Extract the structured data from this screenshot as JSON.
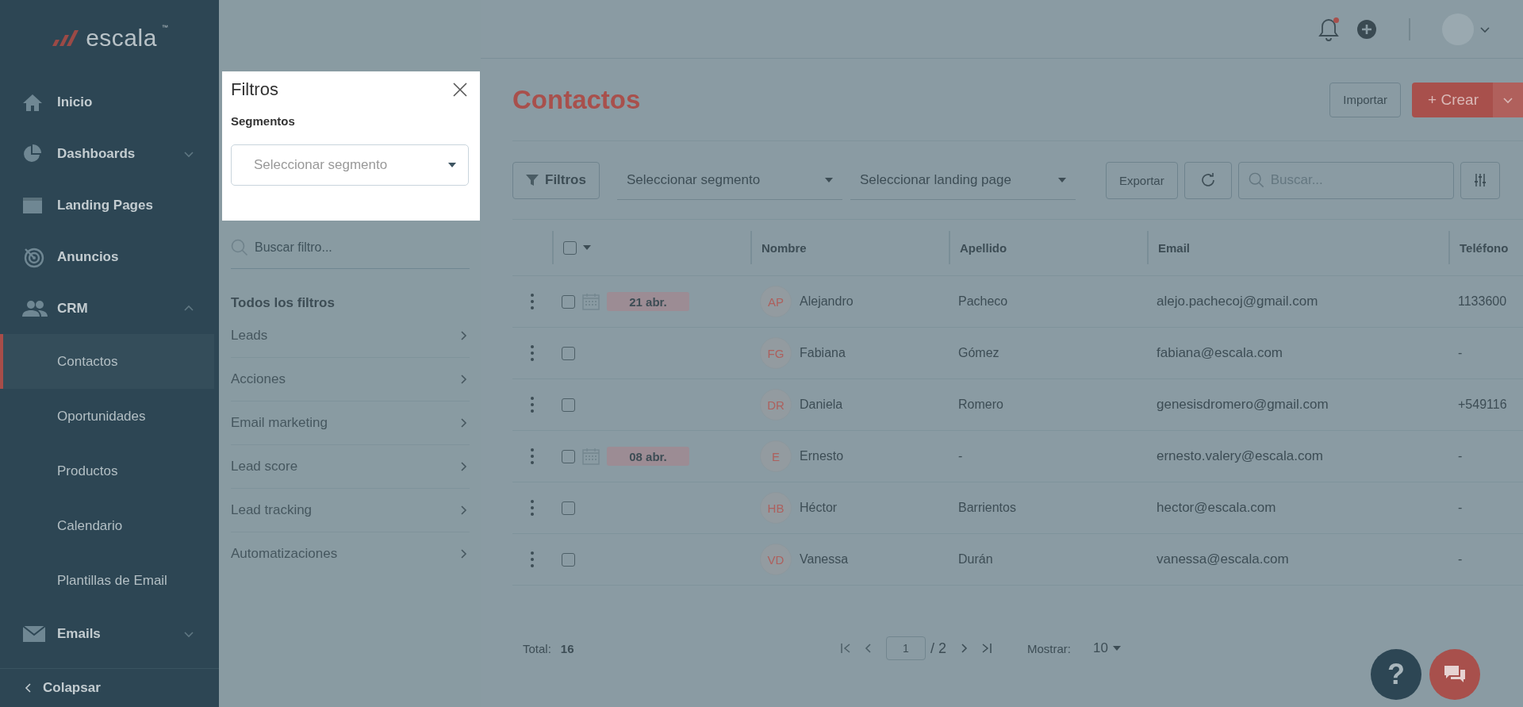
{
  "sidebar": {
    "logo": "escala",
    "logo_trademark": "™",
    "items": [
      {
        "label": "Inicio",
        "selected": false
      },
      {
        "label": "Dashboards",
        "selected": false,
        "expanded": false
      },
      {
        "label": "Landing Pages",
        "selected": false
      },
      {
        "label": "Anuncios",
        "selected": false
      },
      {
        "label": "CRM",
        "selected": false,
        "expanded": true,
        "children": [
          {
            "label": "Contactos",
            "selected": true
          },
          {
            "label": "Oportunidades",
            "selected": false
          },
          {
            "label": "Productos",
            "selected": false
          },
          {
            "label": "Calendario",
            "selected": false
          },
          {
            "label": "Plantillas de Email",
            "selected": false
          }
        ]
      },
      {
        "label": "Emails",
        "selected": false,
        "expanded": false
      }
    ],
    "collapse": "Colapsar"
  },
  "topbar": {
    "notifications_unread": true
  },
  "filter_panel": {
    "title": "Filtros",
    "segment_label": "Segmentos",
    "segment_placeholder": "Seleccionar segmento",
    "search_placeholder": "Buscar filtro...",
    "section_title": "Todos los filtros",
    "categories": [
      "Leads",
      "Acciones",
      "Email marketing",
      "Lead score",
      "Lead tracking",
      "Automatizaciones"
    ]
  },
  "page": {
    "title": "Contactos",
    "import_button": "Importar",
    "create_button": "+ Crear"
  },
  "toolbar": {
    "filters_button": "Filtros",
    "segment_placeholder": "Seleccionar segmento",
    "landing_placeholder": "Seleccionar landing page",
    "export_button": "Exportar",
    "search_placeholder": "Buscar..."
  },
  "table": {
    "select_all_checked": false,
    "columns": [
      "Nombre",
      "Apellido",
      "Email",
      "Teléfono"
    ],
    "rows": [
      {
        "checked": false,
        "date": "21 abr.",
        "initials": "AP",
        "name": "Alejandro",
        "surname": "Pacheco",
        "email": "alejo.pachecoj@gmail.com",
        "phone": "1133600"
      },
      {
        "checked": false,
        "initials": "FG",
        "name": "Fabiana",
        "surname": "Gómez",
        "email": "fabiana@escala.com",
        "phone": "-"
      },
      {
        "checked": false,
        "initials": "DR",
        "name": "Daniela",
        "surname": "Romero",
        "email": "genesisdromero@gmail.com",
        "phone": "+549116"
      },
      {
        "checked": false,
        "date": "08 abr.",
        "initials": "E",
        "name": "Ernesto",
        "surname": "-",
        "email": "ernesto.valery@escala.com",
        "phone": "-"
      },
      {
        "checked": false,
        "initials": "HB",
        "name": "Héctor",
        "surname": "Barrientos",
        "email": "hector@escala.com",
        "phone": "-"
      },
      {
        "checked": false,
        "initials": "VD",
        "name": "Vanessa",
        "surname": "Durán",
        "email": "vanessa@escala.com",
        "phone": "-"
      }
    ]
  },
  "footer": {
    "total_label": "Total:",
    "total": "16",
    "page": "1",
    "pages": "/ 2",
    "show_label": "Mostrar:",
    "page_size": "10"
  },
  "help_button": "?"
}
